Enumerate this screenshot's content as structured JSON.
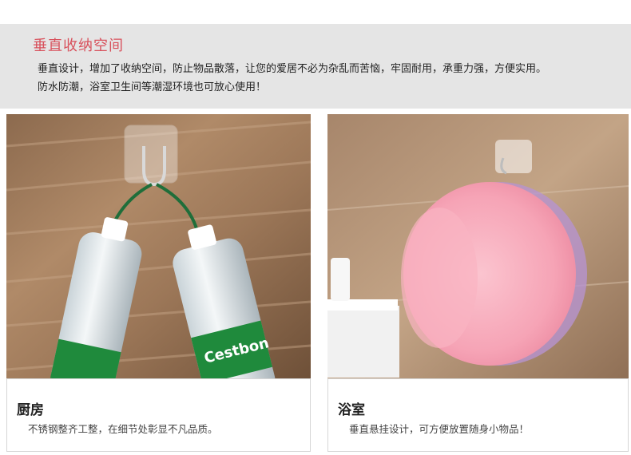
{
  "header": {
    "title": "垂直收纳空间",
    "line1": "垂直设计，增加了收纳空间，防止物品散落，让您的爱居不必为杂乱而苦恼，牢固耐用，承重力强，方便实用。",
    "line2": "防水防潮，浴室卫生间等潮湿环境也可放心使用！"
  },
  "panels": [
    {
      "title": "厨房",
      "description": "不锈钢整齐工整，在细节处彰显不凡品质。",
      "bottle_label_text": "Cestbon"
    },
    {
      "title": "浴室",
      "description": "垂直悬挂设计，可方便放置随身小物品！"
    }
  ],
  "colors": {
    "accent": "#d8515c",
    "banner_bg": "#e5e5e5",
    "basin": "#f6a4b6",
    "bottle_label": "#1f8a3c"
  }
}
